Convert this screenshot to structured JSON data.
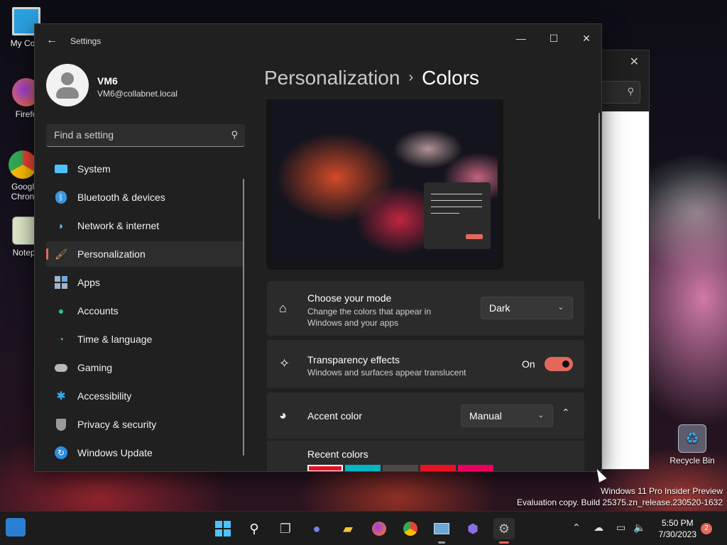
{
  "desktop": {
    "icons": [
      {
        "label": "My Com",
        "icon": "computer-icon"
      },
      {
        "label": "Firefo",
        "icon": "firefox-icon"
      },
      {
        "label": "Googl Chron",
        "icon": "chrome-icon"
      },
      {
        "label": "Notepa",
        "icon": "notepad-icon"
      },
      {
        "label": "Recycle Bin",
        "icon": "recycle-bin-icon"
      }
    ],
    "watermark": {
      "line1": "Windows 11 Pro Insider Preview",
      "line2": "Evaluation copy. Build 25375.zn_release.230520-1632"
    }
  },
  "settings": {
    "title": "Settings",
    "window_controls": {
      "minimize": "—",
      "maximize": "☐",
      "close": "✕"
    },
    "user": {
      "name": "VM6",
      "email": "VM6@collabnet.local"
    },
    "search": {
      "placeholder": "Find a setting"
    },
    "nav": [
      {
        "label": "System",
        "icon": "system-icon",
        "color": "#4cc2ff"
      },
      {
        "label": "Bluetooth & devices",
        "icon": "bluetooth-icon",
        "color": "#3a96dd"
      },
      {
        "label": "Network & internet",
        "icon": "wifi-icon",
        "color": "#5dc8ff"
      },
      {
        "label": "Personalization",
        "icon": "paintbrush-icon",
        "color": "#e8a060",
        "active": true
      },
      {
        "label": "Apps",
        "icon": "apps-icon",
        "color": "#a0b4d0"
      },
      {
        "label": "Accounts",
        "icon": "accounts-icon",
        "color": "#2fbf9e"
      },
      {
        "label": "Time & language",
        "icon": "clock-globe-icon",
        "color": "#4aa8e8"
      },
      {
        "label": "Gaming",
        "icon": "gamepad-icon",
        "color": "#b8b8b8"
      },
      {
        "label": "Accessibility",
        "icon": "accessibility-icon",
        "color": "#39a9f0"
      },
      {
        "label": "Privacy & security",
        "icon": "shield-icon",
        "color": "#9a9a9a"
      },
      {
        "label": "Windows Update",
        "icon": "update-icon",
        "color": "#2b8fe0"
      }
    ],
    "breadcrumb": {
      "parent": "Personalization",
      "separator": "›",
      "current": "Colors"
    },
    "mode": {
      "title": "Choose your mode",
      "desc": "Change the colors that appear in Windows and your apps",
      "value": "Dark"
    },
    "transparency": {
      "title": "Transparency effects",
      "desc": "Windows and surfaces appear translucent",
      "state": "On"
    },
    "accent": {
      "title": "Accent color",
      "value": "Manual",
      "recent_label": "Recent colors",
      "recent_colors": [
        "#e81123",
        "#00b7c3",
        "#4c4a48",
        "#e81123",
        "#ea005e"
      ]
    },
    "accent_color": "#e3685c"
  },
  "taskbar": {
    "time": "5:50 PM",
    "date": "7/30/2023",
    "notification_count": "2"
  }
}
